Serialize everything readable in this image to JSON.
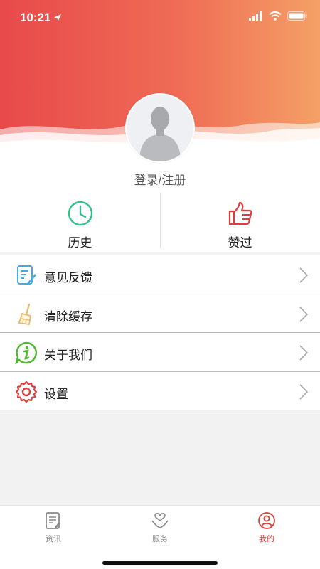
{
  "status_bar": {
    "time": "10:21"
  },
  "profile": {
    "login_label": "登录/注册"
  },
  "quick_actions": [
    {
      "label": "历史",
      "icon": "clock-icon"
    },
    {
      "label": "赞过",
      "icon": "thumbs-up-icon"
    }
  ],
  "menu": [
    {
      "label": "意见反馈",
      "icon": "feedback-icon"
    },
    {
      "label": "清除缓存",
      "icon": "broom-icon"
    },
    {
      "label": "关于我们",
      "icon": "info-icon"
    },
    {
      "label": "设置",
      "icon": "gear-icon"
    }
  ],
  "tabs": [
    {
      "label": "资讯",
      "icon": "news-icon",
      "active": false
    },
    {
      "label": "服务",
      "icon": "heart-hands-icon",
      "active": false
    },
    {
      "label": "我的",
      "icon": "user-icon",
      "active": true
    }
  ],
  "colors": {
    "accent": "#e03c3c",
    "header_start": "#e8494a",
    "header_end": "#f4a066",
    "history_icon": "#2ec28a"
  }
}
